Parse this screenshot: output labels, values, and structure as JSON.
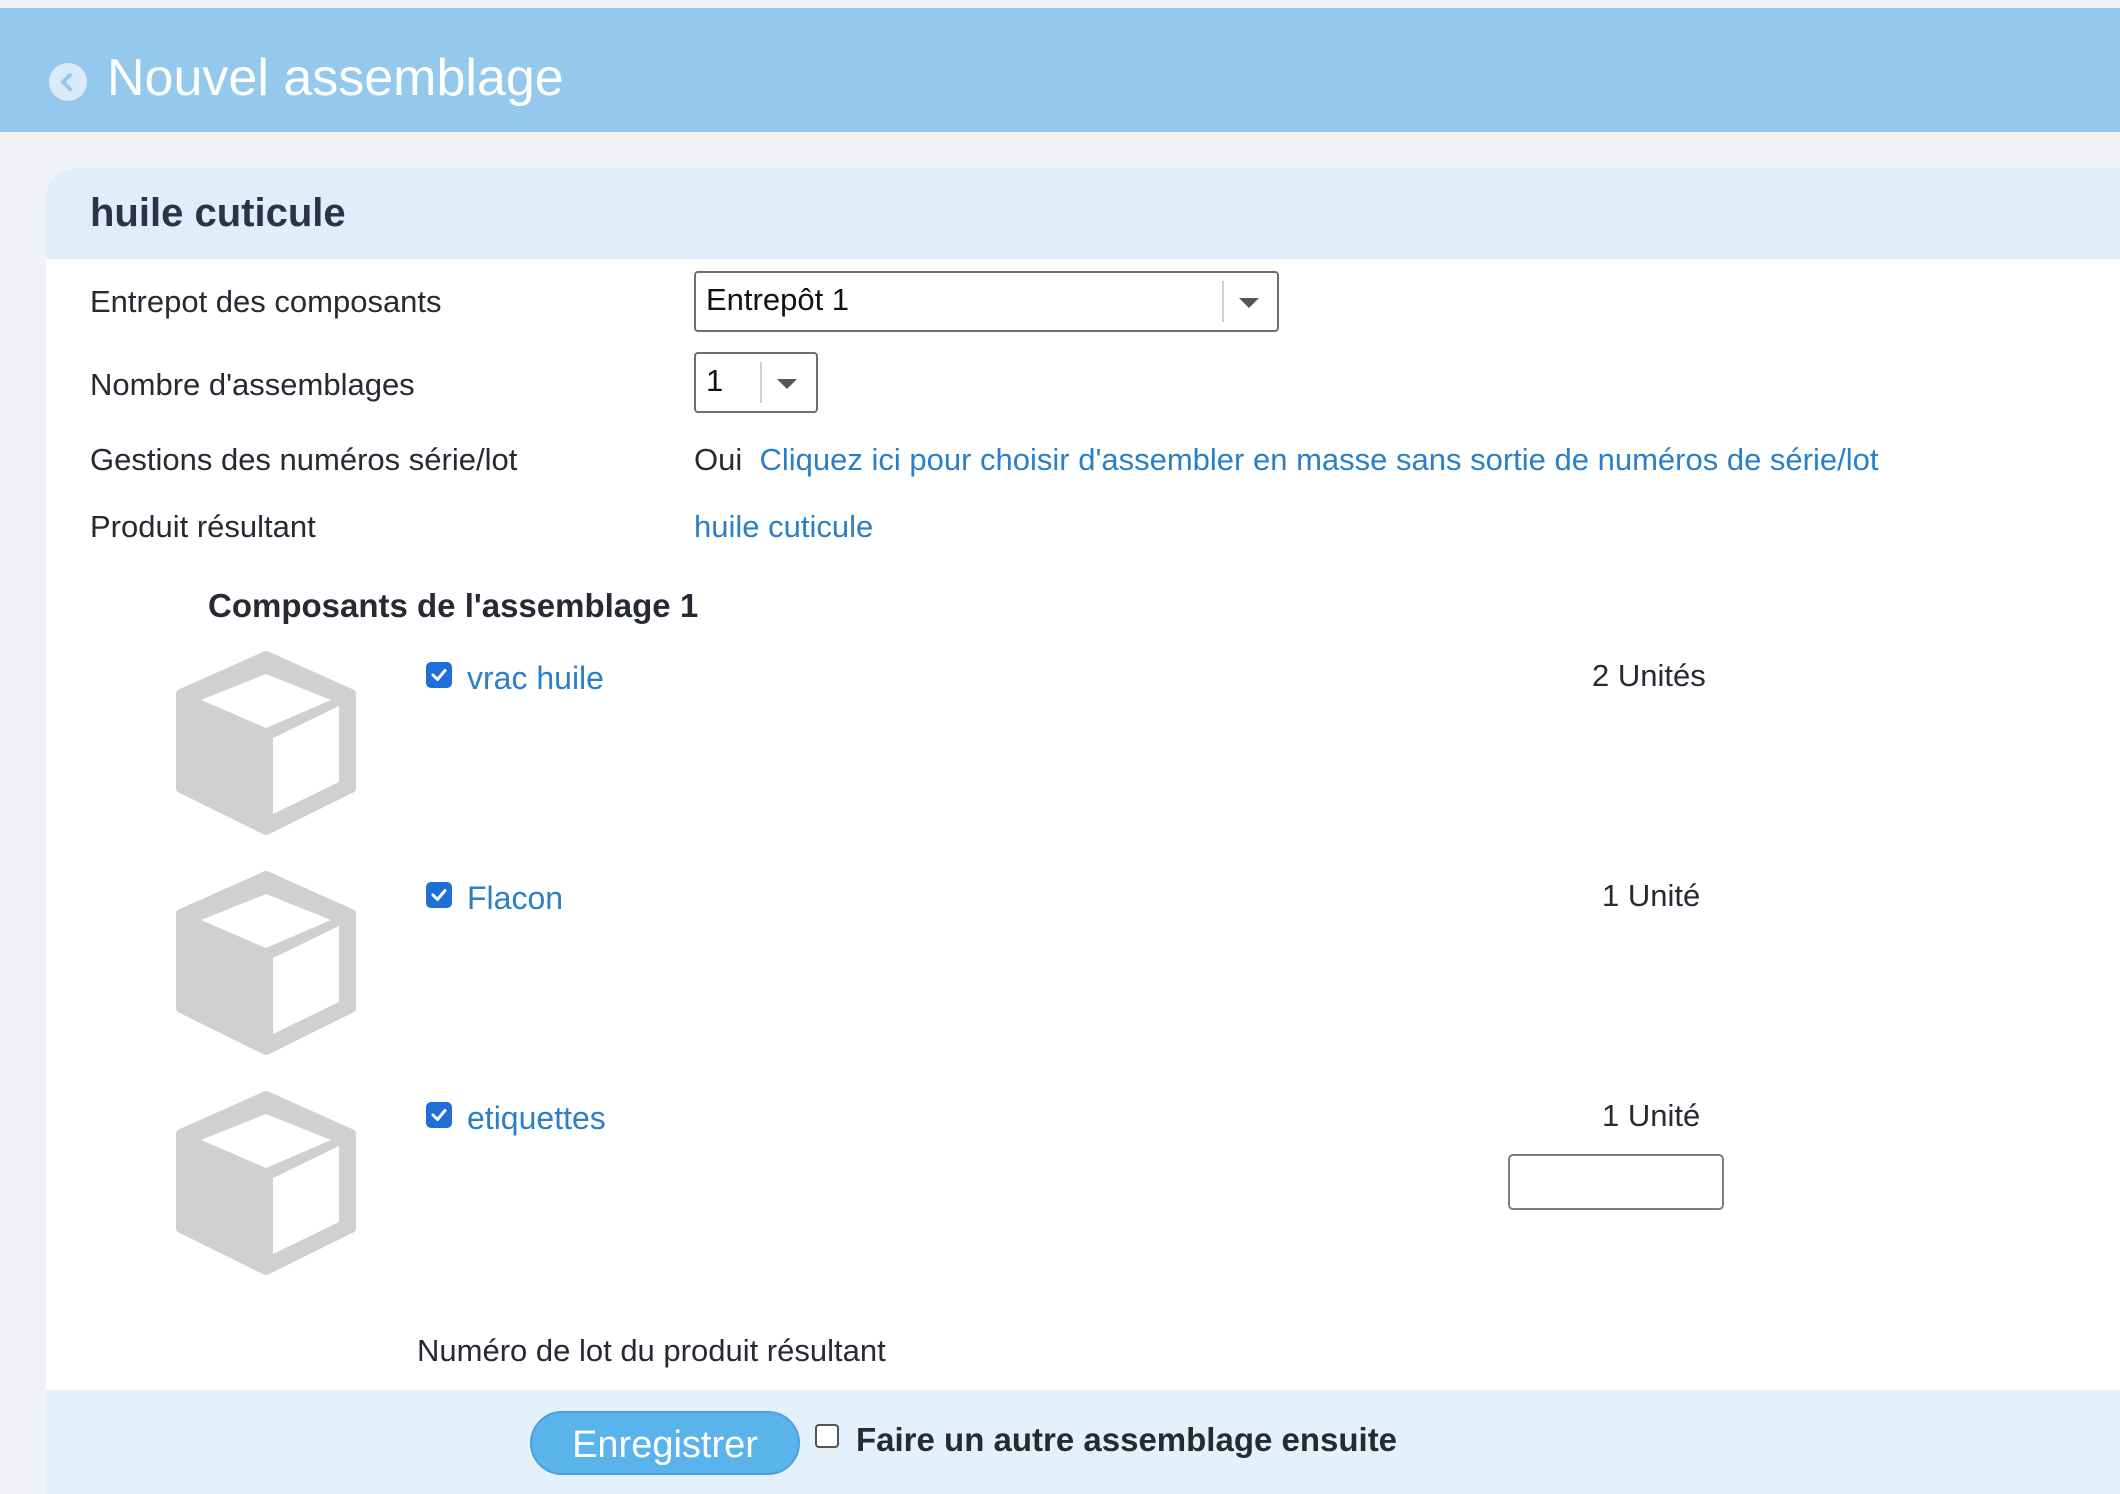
{
  "header": {
    "title": "Nouvel assemblage",
    "back_icon": "chevron-left-icon"
  },
  "card": {
    "title": "huile cuticule"
  },
  "form": {
    "warehouse_label": "Entrepot des composants",
    "warehouse_value": "Entrepôt 1",
    "count_label": "Nombre d'assemblages",
    "count_value": "1",
    "serial_label": "Gestions des numéros série/lot",
    "serial_value": "Oui",
    "serial_link": "Cliquez ici pour choisir d'assembler en masse sans sortie de numéros de série/lot",
    "result_label": "Produit résultant",
    "result_link": "huile cuticule"
  },
  "components": {
    "title": "Composants de l'assemblage 1",
    "items": [
      {
        "name": "vrac huile",
        "qty": "2 Unités",
        "checked": true,
        "icon": "box-icon"
      },
      {
        "name": "Flacon",
        "qty": "1 Unité",
        "checked": true,
        "icon": "box-icon"
      },
      {
        "name": "etiquettes",
        "qty": "1 Unité",
        "checked": true,
        "icon": "box-icon"
      }
    ]
  },
  "lot": {
    "label": "Numéro de lot du produit résultant",
    "value": ""
  },
  "footer": {
    "save_label": "Enregistrer",
    "another_label": "Faire un autre assemblage ensuite",
    "another_checked": false
  },
  "colors": {
    "topbar": "#94c8ec",
    "link": "#2a7fc6",
    "button": "#5ab3ea",
    "checkbox": "#1f6fd6",
    "box": "#d0d0d0"
  }
}
